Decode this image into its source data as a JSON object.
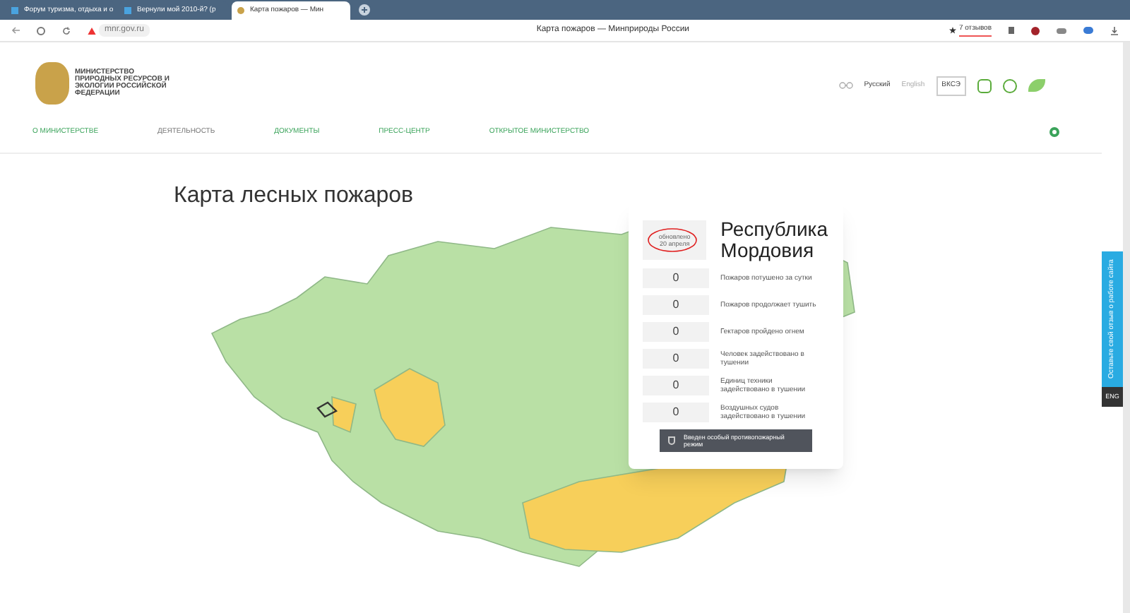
{
  "browser": {
    "tabs": [
      {
        "title": "Форум туризма, отдыха и о",
        "selected": false
      },
      {
        "title": "Вернули мой 2010-й? (р",
        "selected": false
      },
      {
        "title": "Карта пожаров — Мин",
        "selected": true
      }
    ],
    "address": "mnr.gov.ru",
    "page_title": "Карта пожаров — Минприроды России",
    "reviews": "7 отзывов"
  },
  "header": {
    "logo_text": "МИНИСТЕРСТВО ПРИРОДНЫХ РЕСУРСОВ И ЭКОЛОГИИ РОССИЙСКОЙ ФЕДЕРАЦИИ",
    "languages": [
      {
        "label": "Русский",
        "selected": true
      },
      {
        "label": "English",
        "selected": false
      }
    ],
    "vkcs": "ВКСЭ",
    "nav": [
      {
        "label": "О МИНИСТЕРСТВЕ",
        "selected": false
      },
      {
        "label": "ДЕЯТЕЛЬНОСТЬ",
        "selected": true
      },
      {
        "label": "ДОКУМЕНТЫ",
        "selected": false
      },
      {
        "label": "ПРЕСС-ЦЕНТР",
        "selected": false
      },
      {
        "label": "ОТКРЫТОЕ МИНИСТЕРСТВО",
        "selected": false
      }
    ]
  },
  "title": "Карта лесных пожаров",
  "panel": {
    "updated": "обновлено 20 апреля",
    "region": "Республика Мордовия",
    "stats": [
      {
        "value": "0",
        "label": "Пожаров потушено за сутки"
      },
      {
        "value": "0",
        "label": "Пожаров продолжает тушить"
      },
      {
        "value": "0",
        "label": "Гектаров пройдено огнем"
      },
      {
        "value": "0",
        "label": "Человек задействовано в тушении"
      },
      {
        "value": "0",
        "label": "Единиц техники задействовано в тушении"
      },
      {
        "value": "0",
        "label": "Воздушных судов задействовано в тушении"
      }
    ],
    "notice": "Введен особый противопожарный режим"
  },
  "feedback": {
    "label": "Оставьте свой отзыв о работе сайта",
    "lang": "ENG"
  }
}
